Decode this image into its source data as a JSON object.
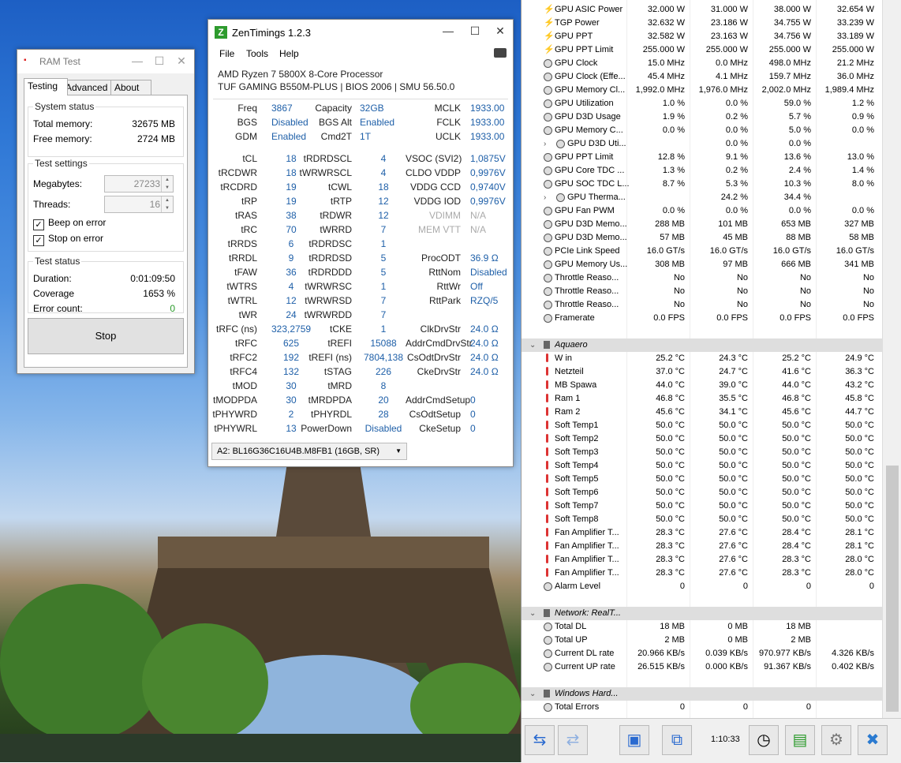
{
  "ramtest": {
    "title": "RAM Test",
    "tabs": [
      "Testing",
      "Advanced",
      "About"
    ],
    "system_status": {
      "title": "System status",
      "total_label": "Total memory:",
      "total_value": "32675 MB",
      "free_label": "Free memory:",
      "free_value": "2724 MB"
    },
    "test_settings": {
      "title": "Test settings",
      "mb_label": "Megabytes:",
      "mb_value": "27233",
      "threads_label": "Threads:",
      "threads_value": "16",
      "beep_label": "Beep on error",
      "stop_label": "Stop on error"
    },
    "test_status": {
      "title": "Test status",
      "duration_label": "Duration:",
      "duration_value": "0:01:09:50",
      "coverage_label": "Coverage",
      "coverage_value": "1653 %",
      "errors_label": "Error count:",
      "errors_value": "0"
    },
    "stop_button": "Stop"
  },
  "zen": {
    "title": "ZenTimings 1.2.3",
    "menu": [
      "File",
      "Tools",
      "Help"
    ],
    "cpu": "AMD Ryzen 7 5800X 8-Core Processor",
    "board": "TUF GAMING B550M-PLUS | BIOS 2006 | SMU 56.50.0",
    "top": [
      [
        "Freq",
        "3867",
        "Capacity",
        "32GB",
        "MCLK",
        "1933.00"
      ],
      [
        "BGS",
        "Disabled",
        "BGS Alt",
        "Enabled",
        "FCLK",
        "1933.00"
      ],
      [
        "GDM",
        "Enabled",
        "Cmd2T",
        "1T",
        "UCLK",
        "1933.00"
      ]
    ],
    "timings": [
      [
        "tCL",
        "18",
        "tRDRDSCL",
        "4",
        "VSOC (SVI2)",
        "1,0875V"
      ],
      [
        "tRCDWR",
        "18",
        "tWRWRSCL",
        "4",
        "CLDO VDDP",
        "0,9976V"
      ],
      [
        "tRCDRD",
        "19",
        "tCWL",
        "18",
        "VDDG CCD",
        "0,9740V"
      ],
      [
        "tRP",
        "19",
        "tRTP",
        "12",
        "VDDG IOD",
        "0,9976V"
      ],
      [
        "tRAS",
        "38",
        "tRDWR",
        "12",
        "VDIMM",
        "N/A"
      ],
      [
        "tRC",
        "70",
        "tWRRD",
        "7",
        "MEM VTT",
        "N/A"
      ],
      [
        "tRRDS",
        "6",
        "tRDRDSC",
        "1",
        "",
        ""
      ],
      [
        "tRRDL",
        "9",
        "tRDRDSD",
        "5",
        "ProcODT",
        "36.9 Ω"
      ],
      [
        "tFAW",
        "36",
        "tRDRDDD",
        "5",
        "RttNom",
        "Disabled"
      ],
      [
        "tWTRS",
        "4",
        "tWRWRSC",
        "1",
        "RttWr",
        "Off"
      ],
      [
        "tWTRL",
        "12",
        "tWRWRSD",
        "7",
        "RttPark",
        "RZQ/5"
      ],
      [
        "tWR",
        "24",
        "tWRWRDD",
        "7",
        "",
        ""
      ],
      [
        "tRFC (ns)",
        "323,2759",
        "tCKE",
        "1",
        "ClkDrvStr",
        "24.0 Ω"
      ],
      [
        "tRFC",
        "625",
        "tREFI",
        "15088",
        "AddrCmdDrvStr",
        "24.0 Ω"
      ],
      [
        "tRFC2",
        "192",
        "tREFI (ns)",
        "7804,138",
        "CsOdtDrvStr",
        "24.0 Ω"
      ],
      [
        "tRFC4",
        "132",
        "tSTAG",
        "226",
        "CkeDrvStr",
        "24.0 Ω"
      ],
      [
        "tMOD",
        "30",
        "tMRD",
        "8",
        "",
        ""
      ],
      [
        "tMODPDA",
        "30",
        "tMRDPDA",
        "20",
        "AddrCmdSetup",
        "0"
      ],
      [
        "tPHYWRD",
        "2",
        "tPHYRDL",
        "28",
        "CsOdtSetup",
        "0"
      ],
      [
        "tPHYWRL",
        "13",
        "PowerDown",
        "Disabled",
        "CkeSetup",
        "0"
      ]
    ],
    "dimm_select": "A2: BL16G36C16U4B.M8FB1 (16GB, SR)"
  },
  "hwinfo": {
    "rows": [
      {
        "t": "bolt",
        "n": "GPU ASIC Power",
        "v": [
          "32.000 W",
          "31.000 W",
          "38.000 W",
          "32.654 W"
        ]
      },
      {
        "t": "bolt",
        "n": "TGP Power",
        "v": [
          "32.632 W",
          "23.186 W",
          "34.755 W",
          "33.239 W"
        ]
      },
      {
        "t": "bolt",
        "n": "GPU PPT",
        "v": [
          "32.582 W",
          "23.163 W",
          "34.756 W",
          "33.189 W"
        ]
      },
      {
        "t": "bolt",
        "n": "GPU PPT Limit",
        "v": [
          "255.000 W",
          "255.000 W",
          "255.000 W",
          "255.000 W"
        ]
      },
      {
        "t": "clock",
        "n": "GPU Clock",
        "v": [
          "15.0 MHz",
          "0.0 MHz",
          "498.0 MHz",
          "21.2 MHz"
        ]
      },
      {
        "t": "clock",
        "n": "GPU Clock (Effe...",
        "v": [
          "45.4 MHz",
          "4.1 MHz",
          "159.7 MHz",
          "36.0 MHz"
        ]
      },
      {
        "t": "clock",
        "n": "GPU Memory Cl...",
        "v": [
          "1,992.0 MHz",
          "1,976.0 MHz",
          "2,002.0 MHz",
          "1,989.4 MHz"
        ]
      },
      {
        "t": "clock",
        "n": "GPU Utilization",
        "v": [
          "1.0 %",
          "0.0 %",
          "59.0 %",
          "1.2 %"
        ]
      },
      {
        "t": "clock",
        "n": "GPU D3D Usage",
        "v": [
          "1.9 %",
          "0.2 %",
          "5.7 %",
          "0.9 %"
        ]
      },
      {
        "t": "clock",
        "n": "GPU Memory C...",
        "v": [
          "0.0 %",
          "0.0 %",
          "5.0 %",
          "0.0 %"
        ]
      },
      {
        "t": "clock",
        "n": "GPU D3D Uti...",
        "sub": true,
        "v": [
          "",
          "0.0 %",
          "0.0 %",
          ""
        ]
      },
      {
        "t": "clock",
        "n": "GPU PPT Limit",
        "v": [
          "12.8 %",
          "9.1 %",
          "13.6 %",
          "13.0 %"
        ]
      },
      {
        "t": "clock",
        "n": "GPU Core TDC ...",
        "v": [
          "1.3 %",
          "0.2 %",
          "2.4 %",
          "1.4 %"
        ]
      },
      {
        "t": "clock",
        "n": "GPU SOC TDC L...",
        "v": [
          "8.7 %",
          "5.3 %",
          "10.3 %",
          "8.0 %"
        ]
      },
      {
        "t": "clock",
        "n": "GPU Therma...",
        "sub": true,
        "v": [
          "",
          "24.2 %",
          "34.4 %",
          ""
        ]
      },
      {
        "t": "clock",
        "n": "GPU Fan PWM",
        "v": [
          "0.0 %",
          "0.0 %",
          "0.0 %",
          "0.0 %"
        ]
      },
      {
        "t": "clock",
        "n": "GPU D3D Memo...",
        "v": [
          "288 MB",
          "101 MB",
          "653 MB",
          "327 MB"
        ]
      },
      {
        "t": "clock",
        "n": "GPU D3D Memo...",
        "v": [
          "57 MB",
          "45 MB",
          "88 MB",
          "58 MB"
        ]
      },
      {
        "t": "clock",
        "n": "PCIe Link Speed",
        "v": [
          "16.0 GT/s",
          "16.0 GT/s",
          "16.0 GT/s",
          "16.0 GT/s"
        ]
      },
      {
        "t": "clock",
        "n": "GPU Memory Us...",
        "v": [
          "308 MB",
          "97 MB",
          "666 MB",
          "341 MB"
        ]
      },
      {
        "t": "clock",
        "n": "Throttle Reaso...",
        "v": [
          "No",
          "No",
          "No",
          "No"
        ]
      },
      {
        "t": "clock",
        "n": "Throttle Reaso...",
        "v": [
          "No",
          "No",
          "No",
          "No"
        ]
      },
      {
        "t": "clock",
        "n": "Throttle Reaso...",
        "v": [
          "No",
          "No",
          "No",
          "No"
        ]
      },
      {
        "t": "clock",
        "n": "Framerate",
        "v": [
          "0.0 FPS",
          "0.0 FPS",
          "0.0 FPS",
          "0.0 FPS"
        ]
      },
      {
        "t": "blank",
        "n": "",
        "v": [
          "",
          "",
          "",
          ""
        ]
      },
      {
        "t": "sec",
        "n": "Aquaero",
        "v": [
          "",
          "",
          "",
          ""
        ]
      },
      {
        "t": "therm",
        "n": "W in",
        "v": [
          "25.2 °C",
          "24.3 °C",
          "25.2 °C",
          "24.9 °C"
        ]
      },
      {
        "t": "therm",
        "n": "Netzteil",
        "v": [
          "37.0 °C",
          "24.7 °C",
          "41.6 °C",
          "36.3 °C"
        ]
      },
      {
        "t": "therm",
        "n": "MB Spawa",
        "v": [
          "44.0 °C",
          "39.0 °C",
          "44.0 °C",
          "43.2 °C"
        ]
      },
      {
        "t": "therm",
        "n": "Ram 1",
        "v": [
          "46.8 °C",
          "35.5 °C",
          "46.8 °C",
          "45.8 °C"
        ]
      },
      {
        "t": "therm",
        "n": "Ram 2",
        "v": [
          "45.6 °C",
          "34.1 °C",
          "45.6 °C",
          "44.7 °C"
        ]
      },
      {
        "t": "therm",
        "n": "Soft Temp1",
        "v": [
          "50.0 °C",
          "50.0 °C",
          "50.0 °C",
          "50.0 °C"
        ]
      },
      {
        "t": "therm",
        "n": "Soft Temp2",
        "v": [
          "50.0 °C",
          "50.0 °C",
          "50.0 °C",
          "50.0 °C"
        ]
      },
      {
        "t": "therm",
        "n": "Soft Temp3",
        "v": [
          "50.0 °C",
          "50.0 °C",
          "50.0 °C",
          "50.0 °C"
        ]
      },
      {
        "t": "therm",
        "n": "Soft Temp4",
        "v": [
          "50.0 °C",
          "50.0 °C",
          "50.0 °C",
          "50.0 °C"
        ]
      },
      {
        "t": "therm",
        "n": "Soft Temp5",
        "v": [
          "50.0 °C",
          "50.0 °C",
          "50.0 °C",
          "50.0 °C"
        ]
      },
      {
        "t": "therm",
        "n": "Soft Temp6",
        "v": [
          "50.0 °C",
          "50.0 °C",
          "50.0 °C",
          "50.0 °C"
        ]
      },
      {
        "t": "therm",
        "n": "Soft Temp7",
        "v": [
          "50.0 °C",
          "50.0 °C",
          "50.0 °C",
          "50.0 °C"
        ]
      },
      {
        "t": "therm",
        "n": "Soft Temp8",
        "v": [
          "50.0 °C",
          "50.0 °C",
          "50.0 °C",
          "50.0 °C"
        ]
      },
      {
        "t": "therm",
        "n": "Fan Amplifier T...",
        "v": [
          "28.3 °C",
          "27.6 °C",
          "28.4 °C",
          "28.1 °C"
        ]
      },
      {
        "t": "therm",
        "n": "Fan Amplifier T...",
        "v": [
          "28.3 °C",
          "27.6 °C",
          "28.4 °C",
          "28.1 °C"
        ]
      },
      {
        "t": "therm",
        "n": "Fan Amplifier T...",
        "v": [
          "28.3 °C",
          "27.6 °C",
          "28.3 °C",
          "28.0 °C"
        ]
      },
      {
        "t": "therm",
        "n": "Fan Amplifier T...",
        "v": [
          "28.3 °C",
          "27.6 °C",
          "28.3 °C",
          "28.0 °C"
        ]
      },
      {
        "t": "clock",
        "n": "Alarm Level",
        "v": [
          "0",
          "0",
          "0",
          "0"
        ]
      },
      {
        "t": "blank",
        "n": "",
        "v": [
          "",
          "",
          "",
          ""
        ]
      },
      {
        "t": "sec",
        "n": "Network: RealT...",
        "v": [
          "",
          "",
          "",
          ""
        ]
      },
      {
        "t": "clock",
        "n": "Total DL",
        "v": [
          "18 MB",
          "0 MB",
          "18 MB",
          ""
        ]
      },
      {
        "t": "clock",
        "n": "Total UP",
        "v": [
          "2 MB",
          "0 MB",
          "2 MB",
          ""
        ]
      },
      {
        "t": "clock",
        "n": "Current DL rate",
        "v": [
          "20.966 KB/s",
          "0.039 KB/s",
          "970.977 KB/s",
          "4.326 KB/s"
        ]
      },
      {
        "t": "clock",
        "n": "Current UP rate",
        "v": [
          "26.515 KB/s",
          "0.000 KB/s",
          "91.367 KB/s",
          "0.402 KB/s"
        ]
      },
      {
        "t": "blank",
        "n": "",
        "v": [
          "",
          "",
          "",
          ""
        ]
      },
      {
        "t": "sec",
        "n": "Windows Hard...",
        "v": [
          "",
          "",
          "",
          ""
        ]
      },
      {
        "t": "clock",
        "n": "Total Errors",
        "v": [
          "0",
          "0",
          "0",
          ""
        ]
      }
    ],
    "timer": "1:10:33"
  }
}
